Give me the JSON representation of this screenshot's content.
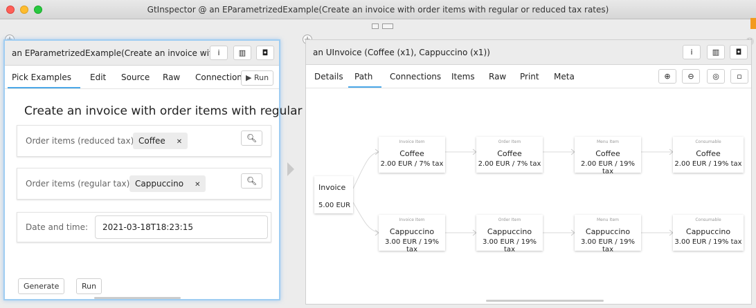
{
  "window": {
    "title": "GtInspector @ an EParametrizedExample(Create an invoice with order items with regular or reduced tax rates)"
  },
  "left": {
    "title": "an EParametrizedExample(Create an invoice with o",
    "tabs": [
      "Pick Examples",
      "Edit",
      "Source",
      "Raw",
      "Connections"
    ],
    "run_label": "▶ Run",
    "heading": "Create an invoice with order items with regular or",
    "reduced": {
      "label": "Order items (reduced tax):",
      "chip": "Coffee"
    },
    "regular": {
      "label": "Order items (regular tax):",
      "chip": "Cappuccino"
    },
    "date": {
      "label": "Date and time:",
      "value": "2021-03-18T18:23:15"
    },
    "generate_label": "Generate",
    "run2_label": "Run"
  },
  "right": {
    "title": "an UInvoice (Coffee (x1), Cappuccino (x1))",
    "tabs": [
      "Details",
      "Path",
      "Connections",
      "Items",
      "Raw",
      "Print",
      "Meta"
    ],
    "active_tab": "Path",
    "root": {
      "name": "Invoice",
      "value": "5.00 EUR"
    },
    "row1": [
      {
        "cat": "Invoice Item",
        "name": "Coffee",
        "value": "2.00 EUR / 7% tax"
      },
      {
        "cat": "Order Item",
        "name": "Coffee",
        "value": "2.00 EUR / 7% tax"
      },
      {
        "cat": "Menu Item",
        "name": "Coffee",
        "value": "2.00 EUR / 19% tax"
      },
      {
        "cat": "Consumable",
        "name": "Coffee",
        "value": "2.00 EUR / 19% tax"
      }
    ],
    "row2": [
      {
        "cat": "Invoice Item",
        "name": "Cappuccino",
        "value": "3.00 EUR / 19% tax"
      },
      {
        "cat": "Order Item",
        "name": "Cappuccino",
        "value": "3.00 EUR / 19% tax"
      },
      {
        "cat": "Menu Item",
        "name": "Cappuccino",
        "value": "3.00 EUR / 19% tax"
      },
      {
        "cat": "Consumable",
        "name": "Cappuccino",
        "value": "3.00 EUR / 19% tax"
      }
    ]
  },
  "icons": {
    "info": "info-icon",
    "book": "book-icon",
    "window": "window-icon",
    "search": "search-icon",
    "zoom_in": "zoom-in-icon",
    "zoom_out": "zoom-out-icon",
    "fit": "fit-icon",
    "square": "square-icon"
  },
  "colors": {
    "accent": "#4aa8e8",
    "close": "#fe5f57",
    "minimize": "#febc2e",
    "maximize": "#28c840",
    "orange": "#f39a1f"
  }
}
